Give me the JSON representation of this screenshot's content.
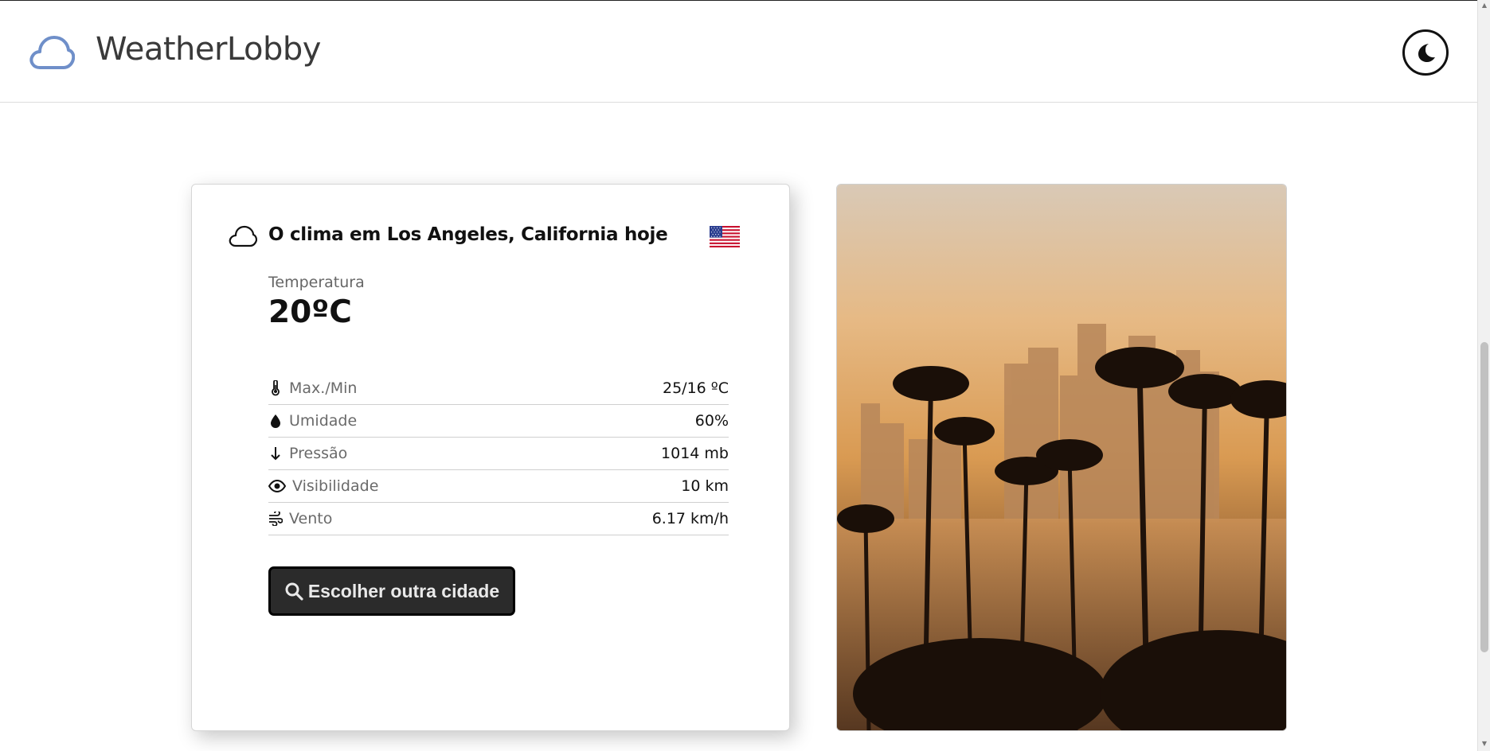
{
  "header": {
    "brand": "WeatherLobby",
    "logo_icon": "cloud-icon",
    "theme_icon": "moon-icon"
  },
  "card": {
    "title": "O clima em Los Angeles, California hoje",
    "title_icon": "cloud-icon",
    "flag": "us-flag-icon",
    "temperature_label": "Temperatura",
    "temperature_value": "20ºC",
    "stats": [
      {
        "icon": "thermometer-icon",
        "label": "Max./Min",
        "value": "25/16 ºC"
      },
      {
        "icon": "water-drop-icon",
        "label": "Umidade",
        "value": "60%"
      },
      {
        "icon": "arrow-down-icon",
        "label": "Pressão",
        "value": "1014 mb"
      },
      {
        "icon": "eye-icon",
        "label": "Visibilidade",
        "value": "10 km"
      },
      {
        "icon": "wind-icon",
        "label": "Vento",
        "value": "6.17 km/h"
      }
    ],
    "search_button": "Escolher outra cidade"
  },
  "photo": {
    "subject": "Los Angeles skyline with palm trees at sunset"
  },
  "colors": {
    "logo_blue": "#6f8fc9",
    "button_bg": "#2b2b2b",
    "muted_text": "#6a6a6a"
  }
}
